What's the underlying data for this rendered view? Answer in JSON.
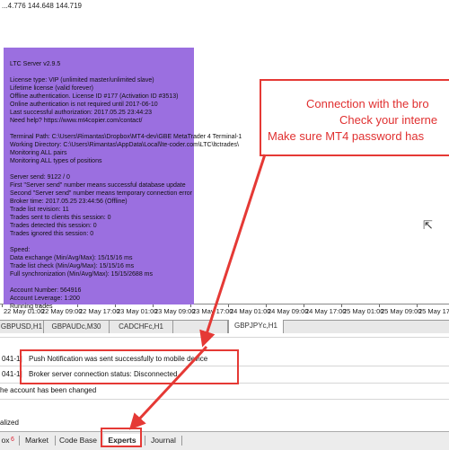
{
  "chart": {
    "ohlc": "...4.776 144.648 144.719",
    "axis_ticks": [
      "22 May 01:00",
      "22 May 09:00",
      "22 May 17:00",
      "23 May 01:00",
      "23 May 09:00",
      "23 May 17:00",
      "24 May 01:00",
      "24 May 09:00",
      "24 May 17:00",
      "25 May 01:00",
      "25 May 09:00",
      "25 May 17:00"
    ]
  },
  "panel": {
    "lines": [
      "LTC Server v2.9.5",
      "",
      "License type: VIP (unlimited master/unlimited slave)",
      "Lifetime license (valid forever)",
      "Offline authentication. License ID #177 (Activation ID #3513)",
      "     Online authentication is not required until 2017-06-10",
      "Last successful authorization: 2017.05.25 23:44:23",
      "Need help? https://www.mt4copier.com/contact/",
      "",
      "Terminal Path: C:\\Users\\Rimantas\\Dropbox\\MT4-dev\\GBE MetaTrader 4 Terminal-1",
      "Working Directory: C:\\Users\\Rimantas\\AppData\\Local\\lte-coder.com\\LTC\\ltctrades\\",
      "Monitoring ALL pairs",
      "Monitoring ALL types of positions",
      "",
      "Server send: 9122 / 0",
      "First \"Server send\" number means successful database update",
      "Second \"Server send\" number means temporary connection error",
      "Broker time: 2017.05.25 23:44:56 (Offline)",
      "Trade list revision: 11",
      "Trades sent to clients this session: 0",
      "Trades detected this session: 0",
      "Trades ignored this session: 0",
      "",
      "Speed:",
      "     Data exchange (Min/Avg/Max): 15/15/16 ms",
      "     Trade list check (Min/Avg/Max): 15/15/16 ms",
      "     Full synchronization (Min/Avg/Max): 15/15/2688 ms",
      "",
      "Account Number: 564916",
      "Account Leverage: 1:200",
      "Running trades"
    ]
  },
  "notice": {
    "line1": "Connection with the bro",
    "line2": "Check your interne",
    "line3": "Make sure MT4 password has"
  },
  "symbol_tabs": [
    "GBPUSD,H1",
    "GBPAUDc,M30",
    "CADCHFc,H1",
    "GBPJPYc,H1"
  ],
  "terminal": {
    "rows": [
      {
        "prefix": "041-1]",
        "message": "Push Notification was sent successfully to mobile device"
      },
      {
        "prefix": "041-1]",
        "message": "Broker server connection status: Disconnected"
      },
      {
        "prefix": "",
        "message": "he account has been changed"
      }
    ],
    "status": "alized"
  },
  "bottom_tabs": {
    "partial": "ox",
    "badge": "6",
    "tabs": [
      "Market",
      "Code Base",
      "Experts",
      "Journal"
    ]
  },
  "colors": {
    "panel": "#9b6fe0",
    "alert": "#e53935"
  }
}
